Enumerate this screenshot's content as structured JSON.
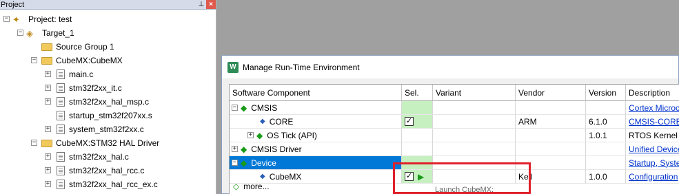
{
  "project": {
    "title": "Project",
    "pin_icon": "pin-icon",
    "close_icon": "close-icon",
    "tree": [
      {
        "label": "Project: test"
      },
      {
        "label": "Target_1"
      },
      {
        "label": "Source Group 1"
      },
      {
        "label": "CubeMX:CubeMX"
      },
      {
        "label": "main.c"
      },
      {
        "label": "stm32f2xx_it.c"
      },
      {
        "label": "stm32f2xx_hal_msp.c"
      },
      {
        "label": "startup_stm32f207xx.s"
      },
      {
        "label": "system_stm32f2xx.c"
      },
      {
        "label": "CubeMX:STM32 HAL Driver"
      },
      {
        "label": "stm32f2xx_hal.c"
      },
      {
        "label": "stm32f2xx_hal_rcc.c"
      },
      {
        "label": "stm32f2xx_hal_rcc_ex.c"
      }
    ]
  },
  "dialog": {
    "title": "Manage Run-Time Environment",
    "columns": [
      "Software Component",
      "Sel.",
      "Variant",
      "Vendor",
      "Version",
      "Description"
    ],
    "rows": [
      {
        "component": "CMSIS",
        "sel": "",
        "variant": "",
        "vendor": "",
        "version": "",
        "description": "Cortex Microc"
      },
      {
        "component": "CORE",
        "sel": "✓",
        "variant": "",
        "vendor": "ARM",
        "version": "6.1.0",
        "description": "CMSIS-CORE f"
      },
      {
        "component": "OS Tick (API)",
        "sel": "",
        "variant": "",
        "vendor": "",
        "version": "1.0.1",
        "description": "RTOS Kernel sy"
      },
      {
        "component": "CMSIS Driver",
        "sel": "",
        "variant": "",
        "vendor": "",
        "version": "",
        "description": "Unified Device"
      },
      {
        "component": "Device",
        "sel": "",
        "variant": "",
        "vendor": "",
        "version": "",
        "description": "Startup, System"
      },
      {
        "component": "CubeMX",
        "sel": "✓",
        "variant": "",
        "vendor": "Keil",
        "version": "1.0.0",
        "description": "Configuration"
      },
      {
        "component": "more...",
        "sel": "",
        "variant": "",
        "vendor": "",
        "version": "",
        "description": ""
      }
    ],
    "launch_tooltip": "Launch CubeMX:",
    "colors": {
      "selected": "#0078d7",
      "green": "#c6f0c0",
      "highlight": "#e0202a"
    }
  }
}
